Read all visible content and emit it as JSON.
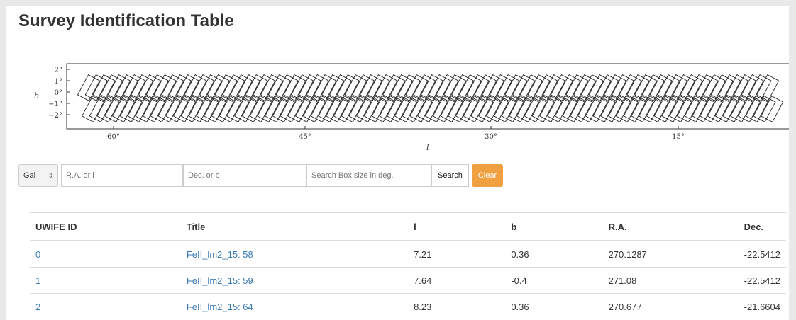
{
  "page": {
    "title": "Survey Identification Table"
  },
  "plot": {
    "y_tick_labels": [
      "2°",
      "1°",
      "0°",
      "−1°",
      "−2°"
    ],
    "x_tick_labels": [
      "60°",
      "45°",
      "30°",
      "15°"
    ],
    "ylabel": "b",
    "xlabel": "l",
    "tile_count": 90
  },
  "search": {
    "coord_system": "Gal",
    "ra_placeholder": "R.A. or l",
    "dec_placeholder": "Dec. or b",
    "box_placeholder": "Search Box size in deg.",
    "search_label": "Search",
    "clear_label": "Clear"
  },
  "table": {
    "headers": [
      "UWIFE ID",
      "Title",
      "l",
      "b",
      "R.A.",
      "Dec."
    ],
    "rows": [
      {
        "id": "0",
        "title": "FeII_lm2_15: 58",
        "l": "7.21",
        "b": "0.36",
        "ra": "270.1287",
        "dec": "-22.5412"
      },
      {
        "id": "1",
        "title": "FeII_lm2_15: 59",
        "l": "7.64",
        "b": "-0.4",
        "ra": "271.08",
        "dec": "-22.5412"
      },
      {
        "id": "2",
        "title": "FeII_lm2_15: 64",
        "l": "8.23",
        "b": "0.36",
        "ra": "270.677",
        "dec": "-21.6604"
      }
    ]
  }
}
